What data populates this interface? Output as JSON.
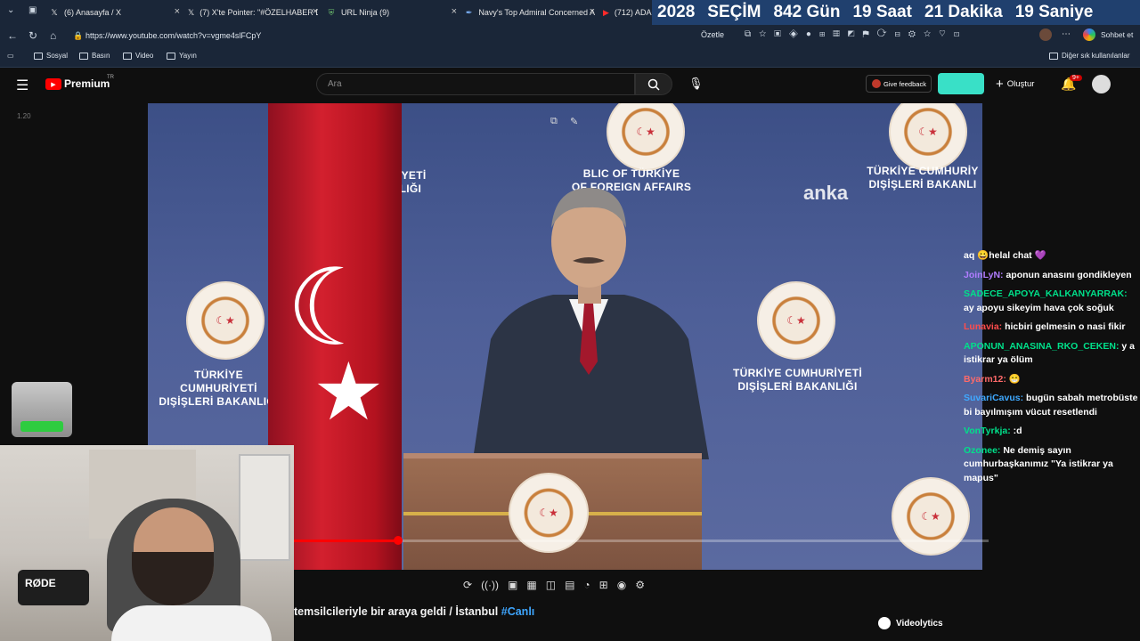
{
  "tabs": [
    {
      "title": "(6) Anasayfa / X",
      "icon": "x-logo-icon"
    },
    {
      "title": "(7) X'te Pointer: \"#ÖZELHABER Dı",
      "icon": "x-logo-icon"
    },
    {
      "title": "URL Ninja (9)",
      "icon": "url-ninja-icon"
    },
    {
      "title": "Navy's Top Admiral Concerned A",
      "icon": "feather-icon"
    },
    {
      "title": "(712) ADAI",
      "icon": "youtube-icon"
    }
  ],
  "countdown": {
    "year": "2028",
    "label": "SEÇİM",
    "days": "842 Gün",
    "hours": "19 Saat",
    "minutes": "21 Dakika",
    "seconds": "19 Saniye"
  },
  "address": {
    "url": "https://www.youtube.com/watch?v=vgme4slFCpY",
    "summarize_label": "Özetle",
    "chat_label": "Sohbet et"
  },
  "bookmarks": {
    "items": [
      "Sosyal",
      "Basın",
      "Video",
      "Yayın"
    ],
    "other": "Diğer sık kullanılanlar"
  },
  "youtube": {
    "logo_text": "Premium",
    "logo_sup": "TR",
    "search_placeholder": "Ara",
    "feedback_label": "Give feedback",
    "create_label": "Oluştur",
    "notification_count": "9+",
    "left_time": "1.20"
  },
  "video": {
    "watermark": "anka",
    "ministry_tr_1": "TÜRKİYE CUMHURİYETİ",
    "ministry_tr_2": "DIŞİŞLERİ BAKANLIĞI",
    "ministry_en_1": "BLIC OF TÜRKİYE",
    "ministry_en_2": "OF FOREIGN AFFAIRS",
    "ministry_left_1": "TÜRKİYE CUMHURİYETİ",
    "ministry_left_2": "DIŞİŞLERİ BAKANLIĞI",
    "ministry_top_1": "TÜRKİYE CUMHURİY",
    "ministry_top_2": "DIŞİŞLERİ BAKANLI",
    "progress": 0.15
  },
  "chat": [
    {
      "user": "",
      "text": "aq 😀helal chat 💜",
      "color": "#ffffff"
    },
    {
      "user": "JoinLyN:",
      "text": "aponun anasını gondikleyen",
      "color": "#b07cff"
    },
    {
      "user": "SADECE_APOYA_KALKANYARRAK:",
      "text": "ay apoyu sikeyim hava çok soğuk",
      "color": "#00e08a"
    },
    {
      "user": "Lunavia:",
      "text": "hicbiri gelmesin o nasi fikir",
      "color": "#ff4d4d"
    },
    {
      "user": "APONUN_ANASINA_RKO_CEKEN:",
      "text": "y a istikrar ya ölüm",
      "color": "#00e08a"
    },
    {
      "user": "Byarm12:",
      "text": "😁",
      "color": "#ff6a6a"
    },
    {
      "user": "SuvariCavus:",
      "text": "bugün sabah metrobüste bi bayılmışım vücut resetlendi",
      "color": "#3fa9ff"
    },
    {
      "user": "VonTyrkja:",
      "text": ":d",
      "color": "#00e08a"
    },
    {
      "user": "Ozonee:",
      "text": "Ne demiş sayın cumhurbaşkanımız \"Ya istikrar ya mapus\"",
      "color": "#00e08a"
    }
  ],
  "webcam": {
    "mic_brand": "RØDE"
  },
  "video_title": {
    "text": "temsilcileriyle bir araya geldi / İstanbul",
    "tag": "#Canlı"
  },
  "videolytics": "Videolytics"
}
